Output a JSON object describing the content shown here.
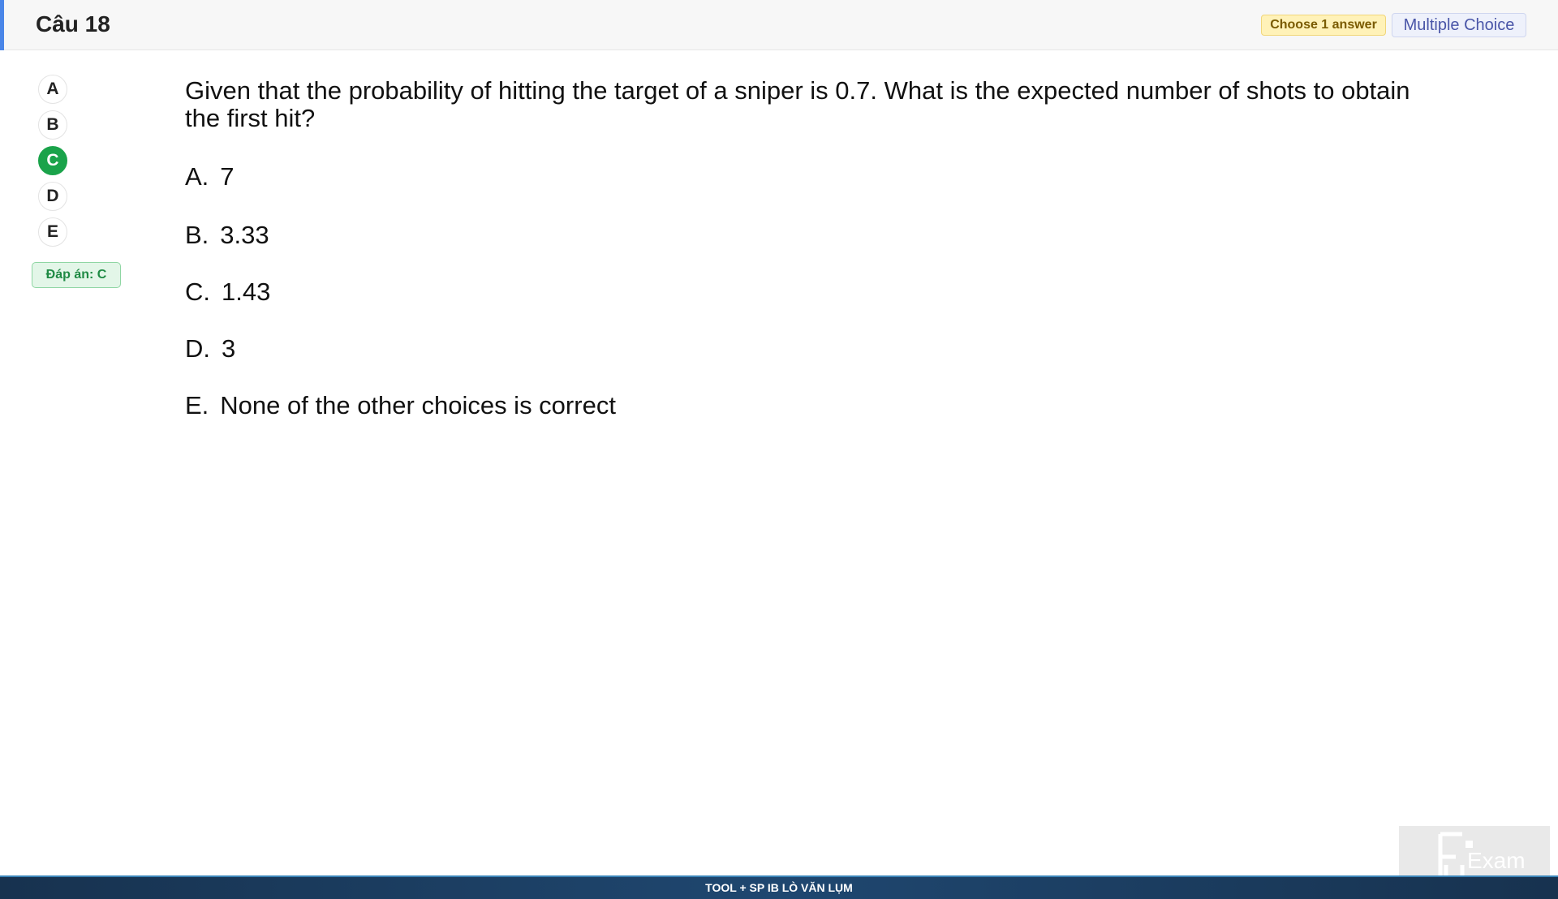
{
  "header": {
    "title": "Câu 18",
    "choose_badge": "Choose 1 answer",
    "type_badge": "Multiple Choice"
  },
  "sidebar": {
    "options": [
      "A",
      "B",
      "C",
      "D",
      "E"
    ],
    "selected": "C",
    "answer_label": "Đáp án: C"
  },
  "question": {
    "text": "Given that the probability of hitting the target of a sniper is 0.7. What is the expected number of shots to obtain the first hit?",
    "choices": [
      {
        "letter": "A.",
        "text": "7"
      },
      {
        "letter": "B.",
        "text": "3.33"
      },
      {
        "letter": "C.",
        "text": "1.43"
      },
      {
        "letter": "D.",
        "text": "3"
      },
      {
        "letter": "E.",
        "text": "None of the other choices is correct"
      }
    ]
  },
  "footer": {
    "text": "TOOL + SP IB LÒ VĂN LỤM"
  },
  "watermark": {
    "text": "Exam",
    "icon": "fu-exam-logo-icon"
  },
  "colors": {
    "accent": "#4a86e8",
    "selected": "#1aa34a",
    "answer_bg": "#e3f6e8",
    "footer_bg": "#1f4770"
  }
}
